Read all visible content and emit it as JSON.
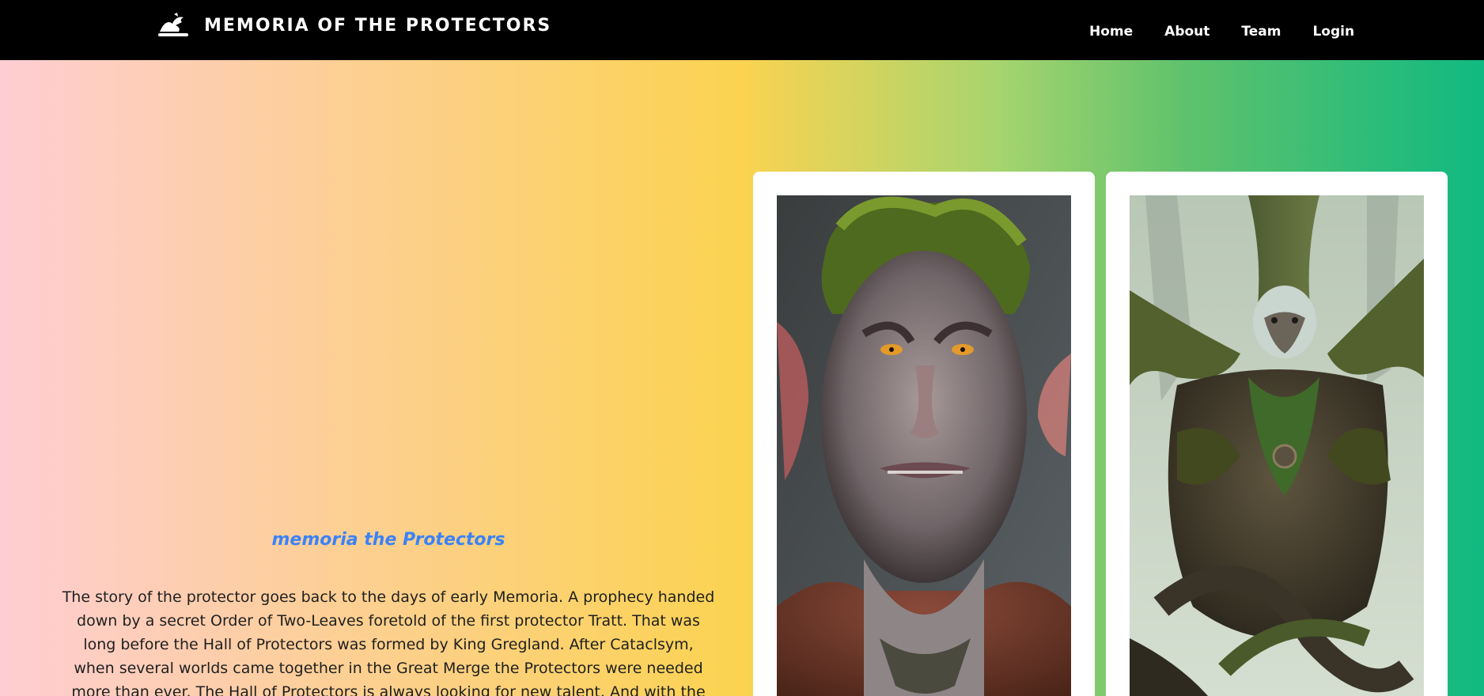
{
  "header": {
    "title": "MEMORIA OF THE PROTECTORS",
    "logo_icon": "dragon-icon",
    "nav": [
      {
        "label": "Home"
      },
      {
        "label": "About"
      },
      {
        "label": "Team"
      },
      {
        "label": "Login"
      }
    ]
  },
  "hero": {
    "heading": "memoria the Protectors",
    "body": "The story of the protector goes back to the days of early Memoria. A prophecy handed down by a secret Order of Two-Leaves foretold of the first protector Tratt. That was long before the Hall of Protectors was formed by King Gregland. After Cataclsym, when several worlds came together in the Great Merge the Protectors were needed more than ever. The Hall of Protectors is always looking for new talent. And with the world so close to peace it wont be",
    "heading_color": "#3b82f6",
    "gradient_colors": [
      "#fecdd3",
      "#fbd350",
      "#10b981"
    ]
  },
  "cards": [
    {
      "image": "troll-portrait-image"
    },
    {
      "image": "tree-beast-image"
    }
  ]
}
